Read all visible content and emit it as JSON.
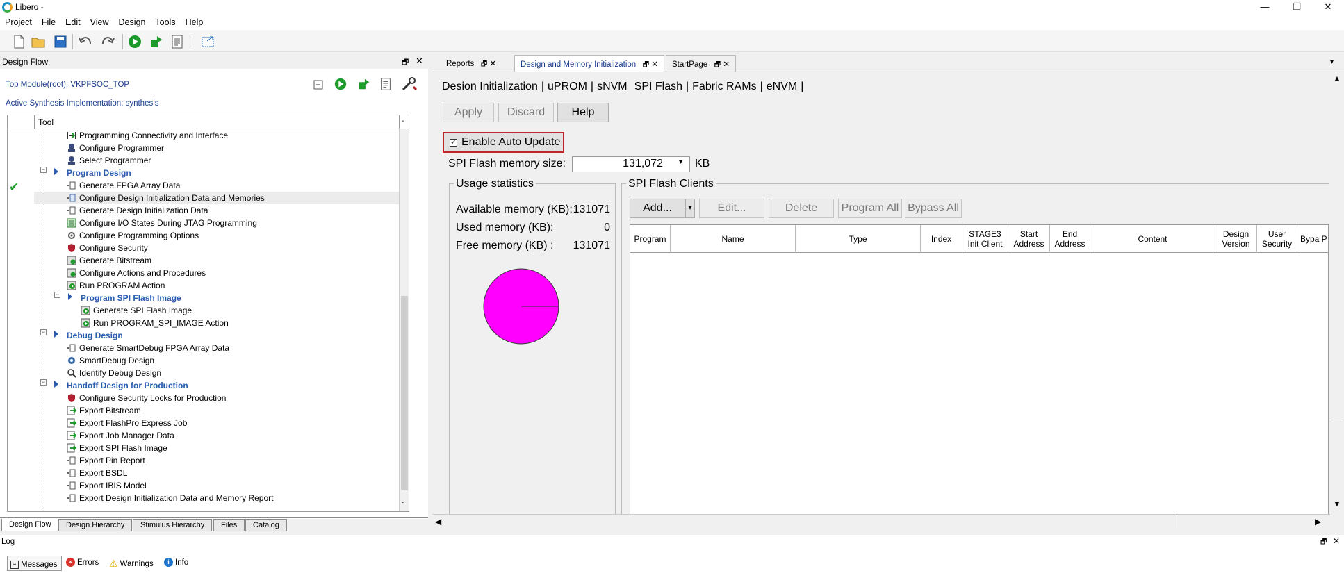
{
  "window": {
    "title": "Libero -",
    "controls": [
      "—",
      "❐",
      "✕"
    ]
  },
  "menu": [
    "Project",
    "File",
    "Edit",
    "View",
    "Design",
    "Tools",
    "Help"
  ],
  "design_flow": {
    "panel_title": "Design Flow",
    "top_module": "Top Module(root): VKPFSOC_TOP",
    "active_synthesis": "Active Synthesis Implementation: synthesis",
    "column_tool": "Tool",
    "items": [
      {
        "label": "Programming Connectivity and Interface",
        "level": 2
      },
      {
        "label": "Configure Programmer",
        "level": 2
      },
      {
        "label": "Select Programmer",
        "level": 2
      },
      {
        "label": "Program Design",
        "level": 1,
        "category": true
      },
      {
        "label": "Generate FPGA Array Data",
        "level": 2,
        "done": true
      },
      {
        "label": "Configure Design Initialization Data and Memories",
        "level": 2,
        "selected": true
      },
      {
        "label": "Generate Design Initialization Data",
        "level": 2
      },
      {
        "label": "Configure I/O States During JTAG Programming",
        "level": 2
      },
      {
        "label": "Configure Programming Options",
        "level": 2
      },
      {
        "label": "Configure Security",
        "level": 2
      },
      {
        "label": "Generate Bitstream",
        "level": 2
      },
      {
        "label": "Configure Actions and Procedures",
        "level": 2
      },
      {
        "label": "Run PROGRAM Action",
        "level": 2
      },
      {
        "label": "Program SPI Flash Image",
        "level": 2,
        "category": true
      },
      {
        "label": "Generate SPI Flash Image",
        "level": 3
      },
      {
        "label": "Run PROGRAM_SPI_IMAGE Action",
        "level": 3
      },
      {
        "label": "Debug Design",
        "level": 1,
        "category": true
      },
      {
        "label": "Generate SmartDebug FPGA Array Data",
        "level": 2
      },
      {
        "label": "SmartDebug Design",
        "level": 2
      },
      {
        "label": "Identify Debug Design",
        "level": 2
      },
      {
        "label": "Handoff Design for Production",
        "level": 1,
        "category": true
      },
      {
        "label": "Configure Security Locks for Production",
        "level": 2
      },
      {
        "label": "Export Bitstream",
        "level": 2
      },
      {
        "label": "Export FlashPro Express Job",
        "level": 2
      },
      {
        "label": "Export Job Manager Data",
        "level": 2
      },
      {
        "label": "Export SPI Flash Image",
        "level": 2
      },
      {
        "label": "Export Pin Report",
        "level": 2
      },
      {
        "label": "Export BSDL",
        "level": 2
      },
      {
        "label": "Export IBIS Model",
        "level": 2
      },
      {
        "label": "Export Design Initialization Data and Memory Report",
        "level": 2
      }
    ],
    "bottom_tabs": [
      "Design Flow",
      "Design Hierarchy",
      "Stimulus Hierarchy",
      "Files",
      "Catalog"
    ]
  },
  "doc_tabs": [
    "Reports",
    "Design and Memory Initialization",
    "StartPage"
  ],
  "section_tabs": [
    "Desion Initialization",
    "uPROM",
    "sNVM",
    "SPI Flash",
    "Fabric RAMs",
    "eNVM"
  ],
  "buttons": {
    "apply": "Apply",
    "discard": "Discard",
    "help": "Help"
  },
  "auto_update": {
    "label": "Enable Auto Update",
    "checked": true
  },
  "spi_size": {
    "label": "SPI Flash memory size:",
    "value": "131,072",
    "unit": "KB"
  },
  "usage": {
    "title": "Usage statistics",
    "available_label": "Available memory (KB):",
    "available_value": "131071",
    "used_label": "Used memory (KB):",
    "used_value": "0",
    "free_label": "Free memory (KB) :",
    "free_value": "131071",
    "pie_color": "#ff00ff"
  },
  "clients": {
    "title": "SPI Flash Clients",
    "add": "Add...",
    "edit": "Edit...",
    "delete": "Delete",
    "program_all": "Program All",
    "bypass_all": "Bypass All",
    "columns": [
      "Program",
      "Name",
      "Type",
      "Index",
      "STAGE3 Init Client",
      "Start Address",
      "End Address",
      "Content",
      "Design Version",
      "User Security",
      "Bypa P"
    ]
  },
  "log": {
    "title": "Log",
    "tabs": [
      "Messages",
      "Errors",
      "Warnings",
      "Info"
    ]
  }
}
